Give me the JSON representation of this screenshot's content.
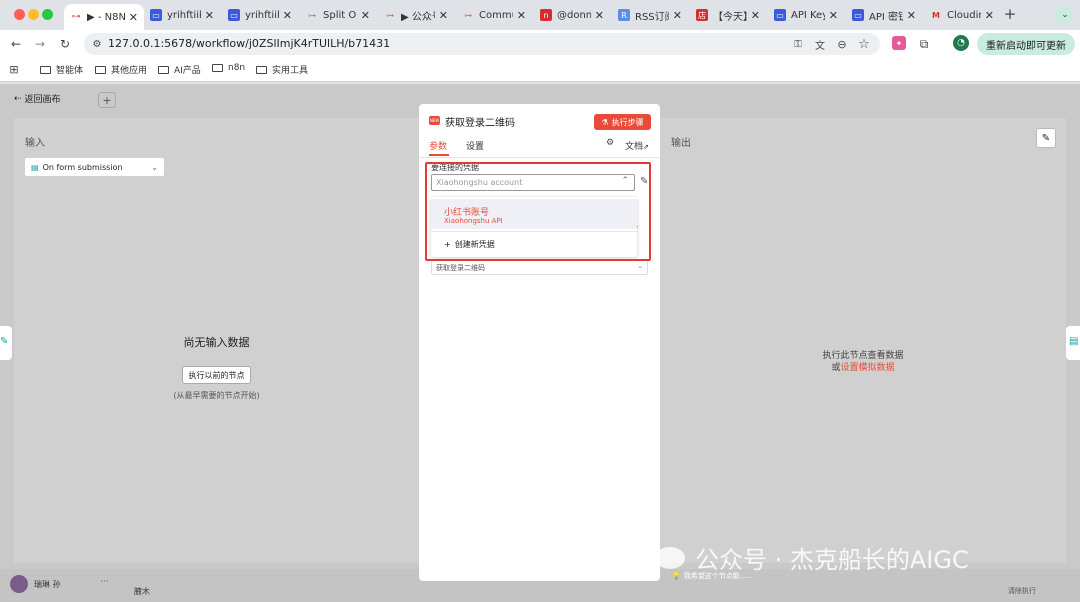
{
  "browser": {
    "tabs": [
      {
        "label": "▶ - N8N",
        "color": "#e05d5d",
        "active": true
      },
      {
        "label": "yrihftiik",
        "color": "#3b5bdb"
      },
      {
        "label": "yrihftiik",
        "color": "#3b5bdb"
      },
      {
        "label": "Split Ou",
        "color": "#888888"
      },
      {
        "label": "▶ 公众号",
        "color": "#e05d5d"
      },
      {
        "label": "Commu",
        "color": "#e05d5d"
      },
      {
        "label": "@donn",
        "color": "#d32f2f"
      },
      {
        "label": "RSS订阅",
        "color": "#5b8def"
      },
      {
        "label": "【今天】",
        "color": "#d32f2f"
      },
      {
        "label": "API Key",
        "color": "#3b5bdb"
      },
      {
        "label": "API 密钥",
        "color": "#3b5bdb"
      },
      {
        "label": "Cloudin",
        "color": "#d93025"
      }
    ],
    "url": "127.0.0.1:5678/workflow/j0ZSlImjK4rTUlLH/b71431",
    "update_button": "重新启动即可更新",
    "bookmarks": [
      "智能体",
      "其他应用",
      "AI产品",
      "n8n",
      "实用工具"
    ]
  },
  "canvas": {
    "back_label": "返回画布",
    "user_name": "瑞琳 孙"
  },
  "input_panel": {
    "title": "输入",
    "trigger_select": "On form submission",
    "empty_title": "尚无输入数据",
    "run_prev_button": "执行以前的节点",
    "hint": "(从最早需要的节点开始)"
  },
  "node": {
    "badge": "NEW",
    "title": "获取登录二维码",
    "execute_button": "执行步骤",
    "tabs": [
      "参数",
      "设置"
    ],
    "docs_label": "文档",
    "credential_label": "要连接的凭据",
    "credential_placeholder": "Xiaohongshu account",
    "dropdown_item_title": "小红书账号",
    "dropdown_item_sub": "Xiaohongshu API",
    "create_credential": "创建新凭据",
    "operation_value": "获取登录二维码",
    "feedback": "我希望这个节点能......"
  },
  "output_panel": {
    "title": "输出",
    "empty_line1": "执行此节点查看数据",
    "empty_line2_prefix": "或",
    "empty_line2_link": "设置模拟数据"
  },
  "bottom": {
    "log_label": "腋木",
    "log_right": "清除执行"
  },
  "watermark": "公众号 · 杰克船长的AIGC",
  "colors": {
    "accent": "#ea4b38",
    "link": "#ea4b38",
    "highlight": "#e53935"
  }
}
